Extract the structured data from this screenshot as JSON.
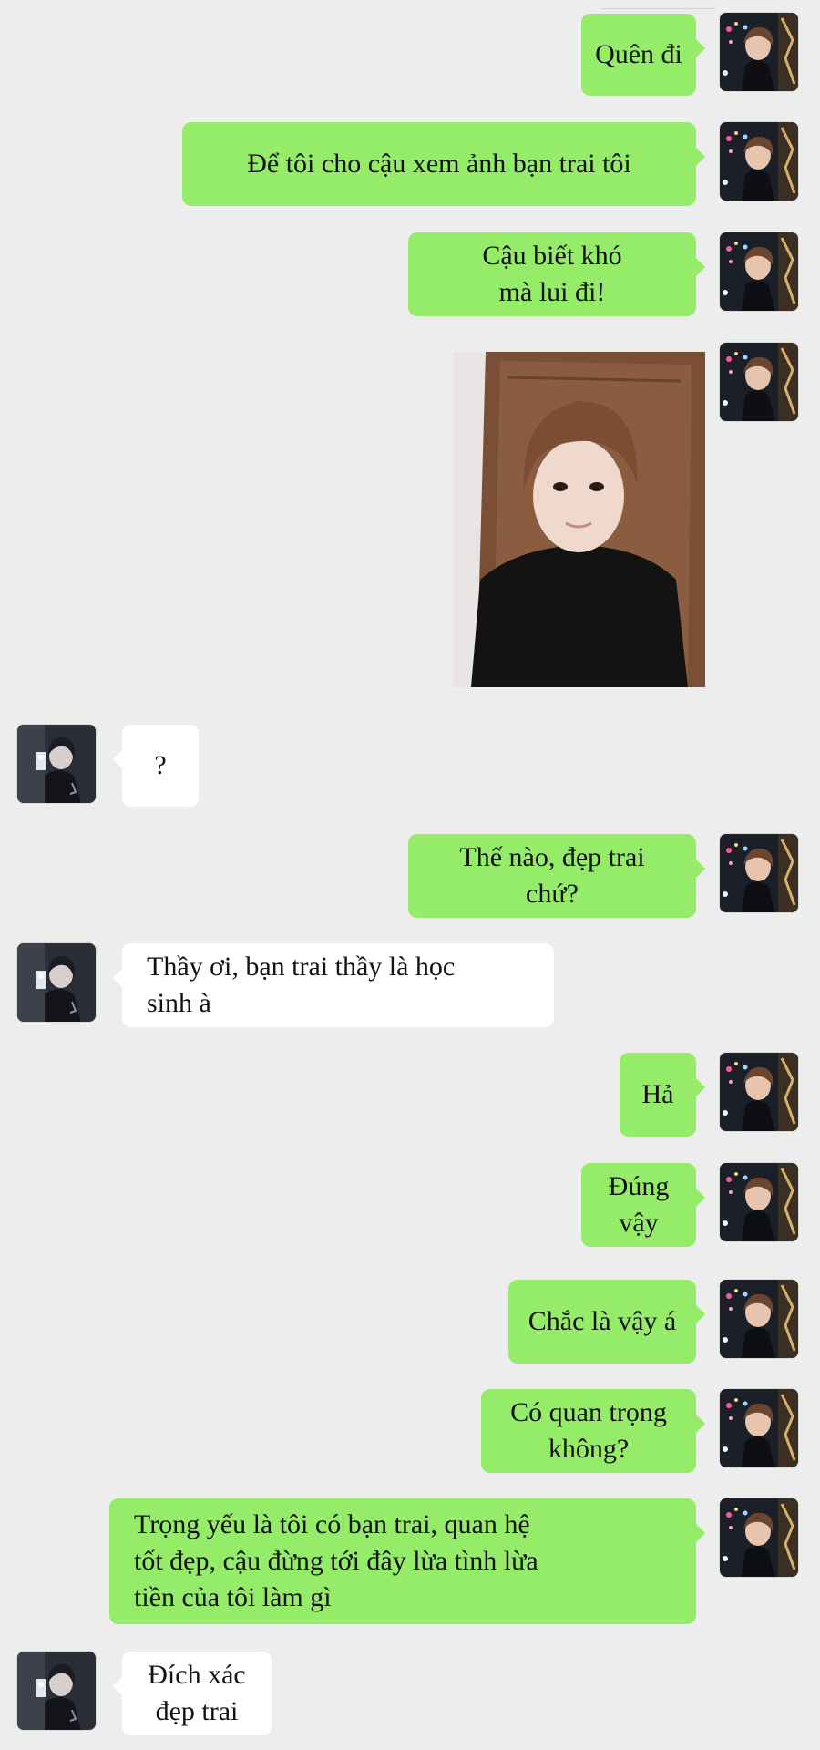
{
  "participants": {
    "me": {
      "avatar_icon": "avatar-boy-night-photo",
      "bubble_color": "#95ec69"
    },
    "them": {
      "avatar_icon": "avatar-boy-mirror-selfie",
      "bubble_color": "#ffffff"
    }
  },
  "messages": [
    {
      "sender": "me",
      "type": "text",
      "text": "Quên đi"
    },
    {
      "sender": "me",
      "type": "text",
      "text": "Để tôi cho cậu xem ảnh bạn trai tôi"
    },
    {
      "sender": "me",
      "type": "text",
      "text": "Cậu biết khó\nmà lui đi!"
    },
    {
      "sender": "me",
      "type": "image",
      "image_icon": "boyfriend-selfie-photo"
    },
    {
      "sender": "them",
      "type": "text",
      "text": "?"
    },
    {
      "sender": "me",
      "type": "text",
      "text": "Thế nào, đẹp trai\nchứ?"
    },
    {
      "sender": "them",
      "type": "text",
      "text": "Thầy ơi, bạn trai thầy là học\nsinh à"
    },
    {
      "sender": "me",
      "type": "text",
      "text": "Hả"
    },
    {
      "sender": "me",
      "type": "text",
      "text": "Đúng\nvậy"
    },
    {
      "sender": "me",
      "type": "text",
      "text": "Chắc là vậy á"
    },
    {
      "sender": "me",
      "type": "text",
      "text": "Có quan trọng\nkhông?"
    },
    {
      "sender": "me",
      "type": "text",
      "text": "Trọng yếu là tôi có bạn trai, quan hệ\ntốt đẹp, cậu đừng tới đây lừa tình lừa\ntiền của tôi làm gì"
    },
    {
      "sender": "them",
      "type": "text",
      "text": "Đích xác\nđẹp trai"
    }
  ]
}
